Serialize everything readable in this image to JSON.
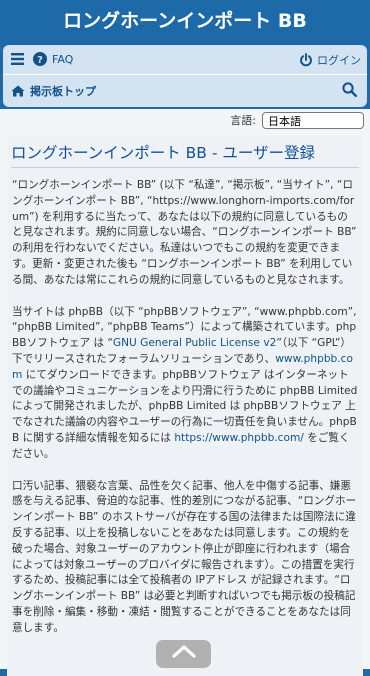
{
  "header": {
    "site_title": "ロングホーンインポート BB"
  },
  "nav": {
    "menu_icon": "hamburger-menu-icon",
    "faq_label": "FAQ",
    "login_label": "ログイン",
    "breadcrumb_home": "掲示板トップ"
  },
  "language": {
    "label": "言語:",
    "selected": "日本語"
  },
  "page": {
    "title": "ロングホーンインポート BB - ユーザー登録",
    "p1": "“ロングホーンインポート BB” (以下 “私達”, “掲示板”, “当サイト”, “ロングホーンインポート BB”, “https://www.longhorn-imports.com/forum”) を利用するに当たって、あなたは以下の規約に同意しているものと見なされます。規約に同意しない場合、“ロングホーンインポート BB” の利用を行わないでください。私達はいつでもこの規約を変更できます。更新・変更された後も “ロングホーンインポート BB” を利用している間、あなたは常にこれらの規約に同意しているものと見なされます。",
    "p2_a": "当サイトは phpBB（以下 “phpBBソフトウェア”, “www.phpbb.com”, “phpBB Limited”, “phpBB Teams”）によって構築されています。phpBBソフトウェア は “",
    "p2_link1": "GNU General Public License v2",
    "p2_b": "”（以下 “GPL”） 下でリリースされたフォーラムソリューションであり、",
    "p2_link2": "www.phpbb.com",
    "p2_c": " にてダウンロードできます。phpBBソフトウェア はインターネットでの議論やコミュニケーションをより円滑に行うために phpBB Limited によって開発されましたが、phpBB Limited は phpBBソフトウェア 上でなされた議論の内容やユーザーの行為に一切責任を負いません。phpBB に関する詳細な情報を知るには ",
    "p2_link3": "https://www.phpbb.com/",
    "p2_d": " をご覧ください。",
    "p3": "口汚い記事、猥褻な言葉、品性を欠く記事、他人を中傷する記事、嫌悪感を与える記事、脅迫的な記事、性的差別につながる記事、“ロングホーンインポート BB” のホストサーバが存在する国の法律または国際法に違反する記事、以上を投稿しないことをあなたは同意します。この規約を破った場合、対象ユーザーのアカウント停止が即座に行われます（場合によっては対象ユーザーのプロバイダに報告されます）。この措置を実行するため、投稿記事には全て投稿者の IPアドレス が記録されます。“ロングホーンインポート BB” は必要と判断すればいつでも掲示板の投稿記事を削除・編集・移動・凍結・閲覧することができることをあなたは同意します。"
  }
}
